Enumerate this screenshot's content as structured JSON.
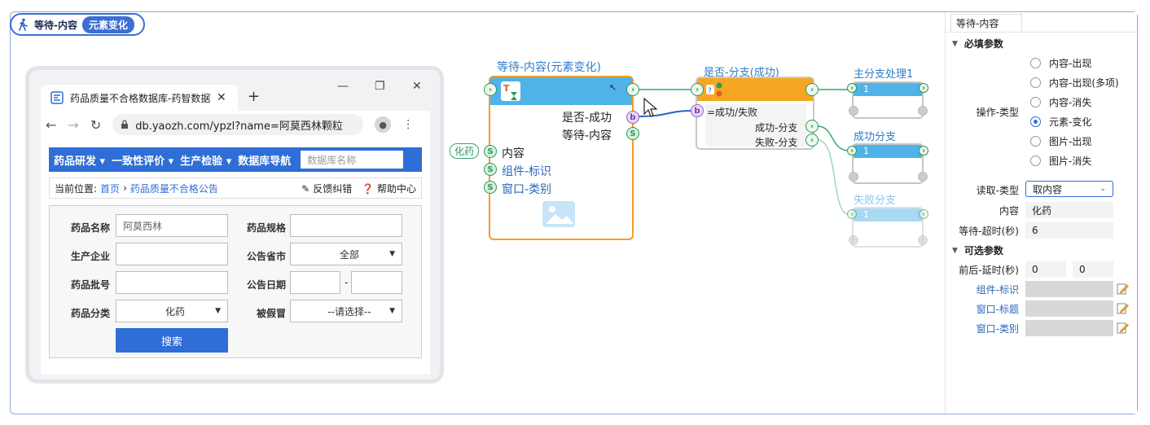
{
  "header": {
    "step_title": "等待-内容",
    "tag": "元素变化"
  },
  "browser": {
    "tab_title": "药品质量不合格数据库-药智数据",
    "url": "db.yaozh.com/ypzl?name=阿莫西林颗粒",
    "nav": [
      "药品研发",
      "一致性评价",
      "生产检验",
      "数据库导航"
    ],
    "search_placeholder": "数据库名称",
    "crumb_prefix": "当前位置:",
    "crumb_home": "首页",
    "crumb_page": "药品质量不合格公告",
    "feedback": "反馈纠错",
    "help": "帮助中心",
    "form": {
      "name_label": "药品名称",
      "name_value": "阿莫西林",
      "spec_label": "药品规格",
      "company_label": "生产企业",
      "province_label": "公告省市",
      "province_value": "全部",
      "batch_label": "药品批号",
      "date_label": "公告日期",
      "date_sep": "-",
      "category_label": "药品分类",
      "category_value": "化药",
      "fake_label": "被假冒",
      "fake_value": "--请选择--",
      "search_button": "搜索"
    }
  },
  "flow": {
    "main_node": {
      "title": "等待-内容(元素变化)",
      "out_success": "是否-成功",
      "out_content": "等待-内容",
      "in_content": "内容",
      "in_component": "组件-标识",
      "in_window": "窗口-类别",
      "input_tag": "化药"
    },
    "branch_node": {
      "title": "是否-分支(成功)",
      "condition": "=成功/失败",
      "out_success": "成功-分支",
      "out_fail": "失败-分支"
    },
    "targets": [
      {
        "title": "主分支处理1",
        "count": "1"
      },
      {
        "title": "成功分支",
        "count": "1"
      },
      {
        "title": "失败分支",
        "count": "1"
      }
    ]
  },
  "panel": {
    "tab": "等待-内容",
    "required_title": "必填参数",
    "op_type_label": "操作-类型",
    "op_options": [
      "内容-出现",
      "内容-出现(多项)",
      "内容-消失",
      "元素-变化",
      "图片-出现",
      "图片-消失"
    ],
    "op_selected": 3,
    "read_type_label": "读取-类型",
    "read_type_value": "取内容",
    "content_label": "内容",
    "content_value": "化药",
    "timeout_label": "等待-超时(秒)",
    "timeout_value": "6",
    "optional_title": "可选参数",
    "delay_label": "前后-延时(秒)",
    "delay_before": "0",
    "delay_after": "0",
    "component_label": "组件-标识",
    "window_title_label": "窗口-标题",
    "window_class_label": "窗口-类别"
  }
}
